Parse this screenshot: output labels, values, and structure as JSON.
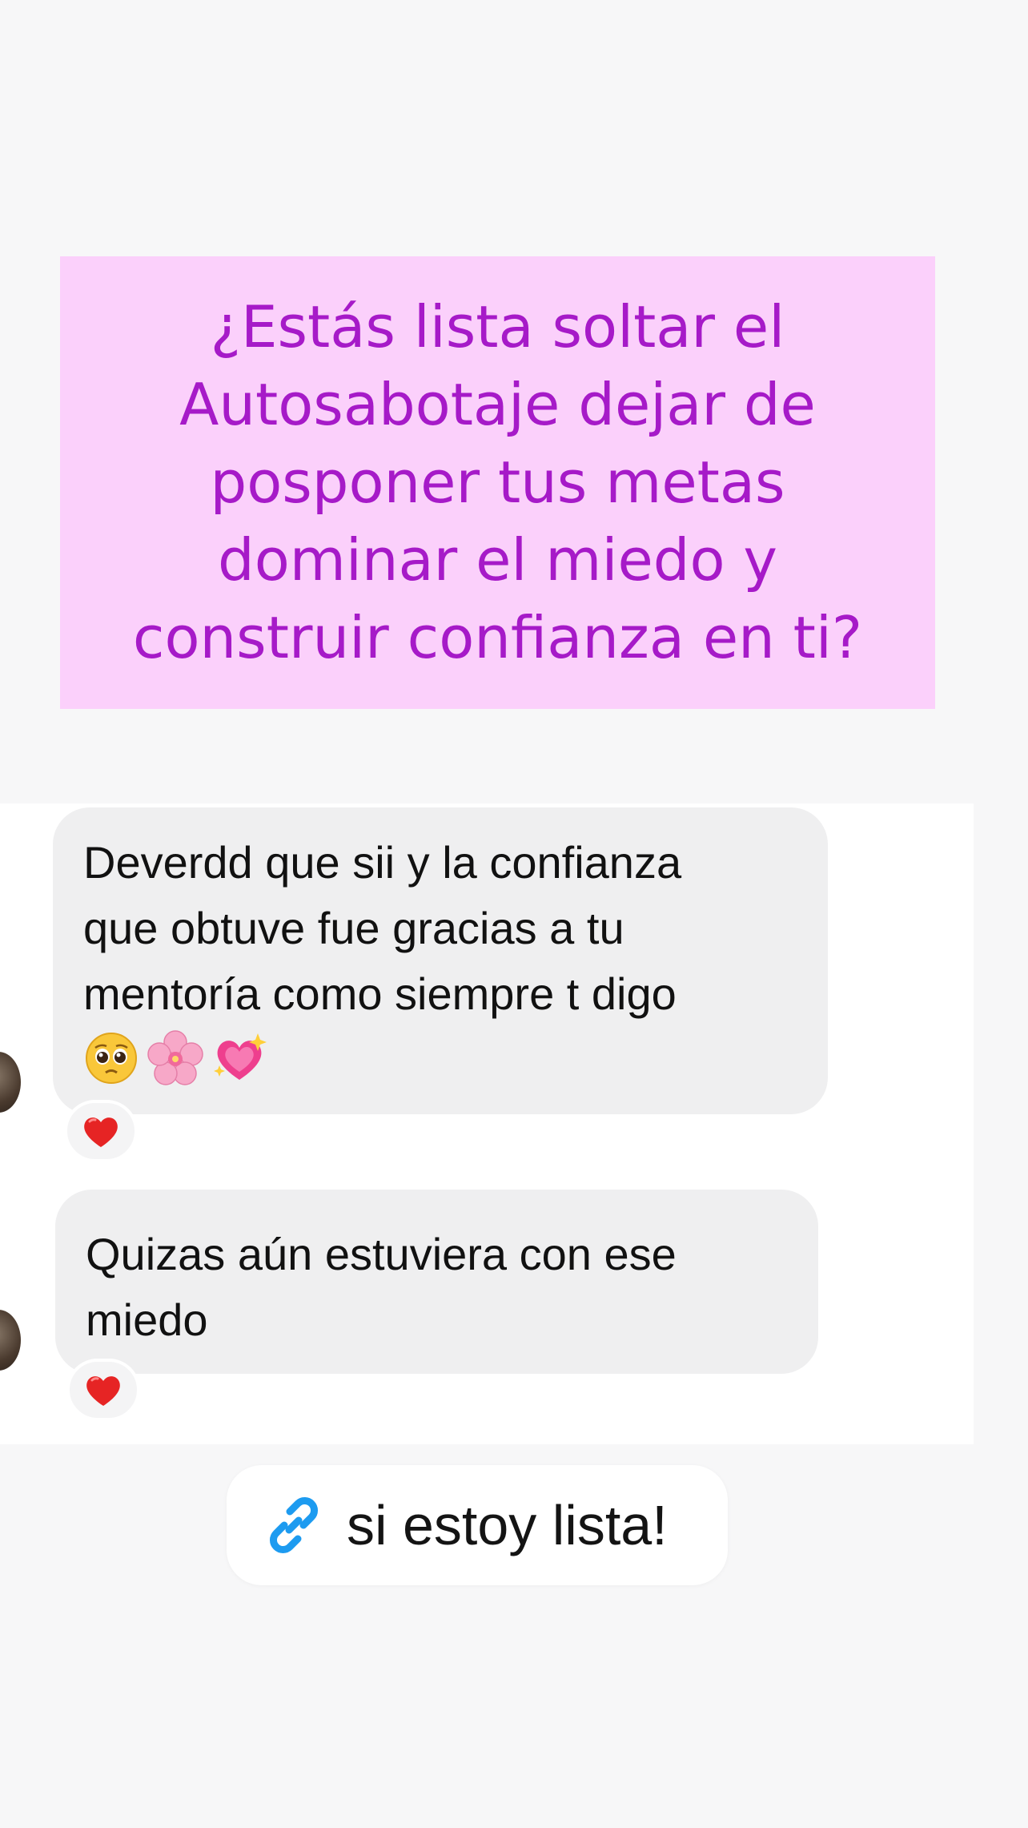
{
  "title_card": {
    "lines": [
      "¿Estás lista soltar el",
      "Autosabotaje dejar de",
      "posponer tus metas",
      "dominar el miedo y",
      "construir confianza en ti?"
    ],
    "background_color": "#fbd0fb",
    "text_color": "#a61ac8"
  },
  "chat": {
    "messages": [
      {
        "lines": [
          "Deverdd que sii y la confianza",
          "que obtuve fue gracias a tu",
          "mentoría como siempre t digo"
        ],
        "emojis": [
          "pleading-face-emoji",
          "cherry-blossom-emoji",
          "sparkling-heart-emoji"
        ],
        "reaction": "red-heart-icon"
      },
      {
        "lines": [
          "Quizas aún estuviera con ese",
          "miedo"
        ],
        "reaction": "red-heart-icon"
      }
    ],
    "bubble_color": "#efeff0"
  },
  "link_sticker": {
    "label": "si estoy lista!",
    "icon": "link-icon",
    "icon_color": "#1d9bf0"
  }
}
